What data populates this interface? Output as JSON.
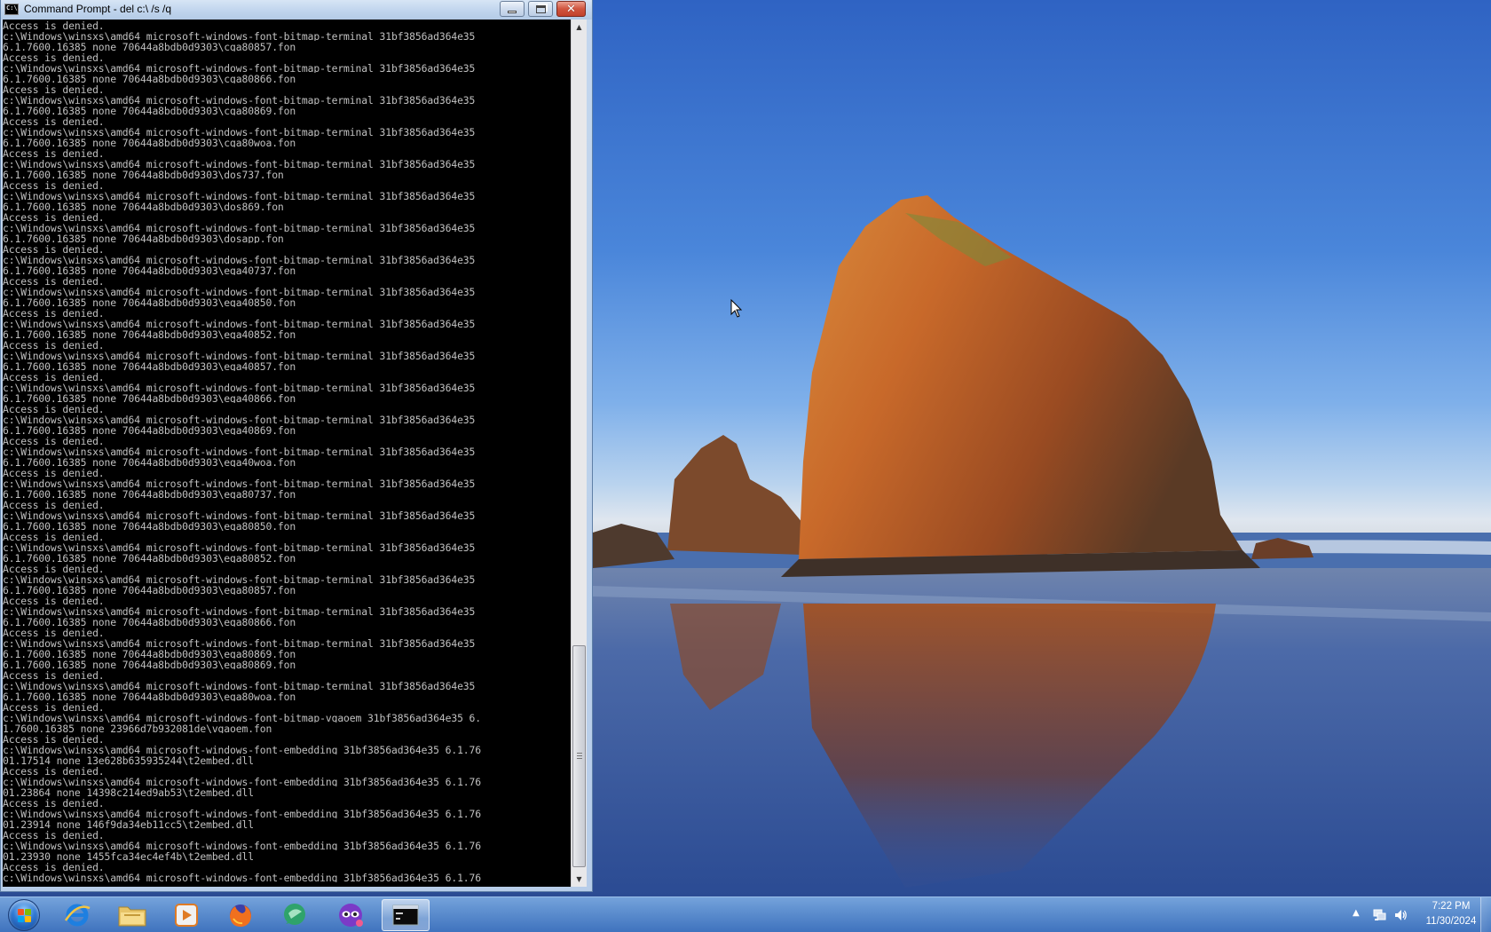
{
  "window": {
    "title": "Command Prompt - del  c:\\ /s /q",
    "app_icon_text": "C:\\.",
    "buttons": {
      "minimize": "minimize",
      "maximize": "restore",
      "close": "✕"
    }
  },
  "console": {
    "text_color": "#c0c0c0",
    "background": "#000000",
    "lines": [
      "Access is denied.",
      "c:\\Windows\\winsxs\\amd64_microsoft-windows-font-bitmap-terminal_31bf3856ad364e35_",
      "6.1.7600.16385_none_70644a8bdb0d9303\\cga80857.fon",
      "Access is denied.",
      "c:\\Windows\\winsxs\\amd64_microsoft-windows-font-bitmap-terminal_31bf3856ad364e35_",
      "6.1.7600.16385_none_70644a8bdb0d9303\\cga80866.fon",
      "Access is denied.",
      "c:\\Windows\\winsxs\\amd64_microsoft-windows-font-bitmap-terminal_31bf3856ad364e35_",
      "6.1.7600.16385_none_70644a8bdb0d9303\\cga80869.fon",
      "Access is denied.",
      "c:\\Windows\\winsxs\\amd64_microsoft-windows-font-bitmap-terminal_31bf3856ad364e35_",
      "6.1.7600.16385_none_70644a8bdb0d9303\\cga80woa.fon",
      "Access is denied.",
      "c:\\Windows\\winsxs\\amd64_microsoft-windows-font-bitmap-terminal_31bf3856ad364e35_",
      "6.1.7600.16385_none_70644a8bdb0d9303\\dos737.fon",
      "Access is denied.",
      "c:\\Windows\\winsxs\\amd64_microsoft-windows-font-bitmap-terminal_31bf3856ad364e35_",
      "6.1.7600.16385_none_70644a8bdb0d9303\\dos869.fon",
      "Access is denied.",
      "c:\\Windows\\winsxs\\amd64_microsoft-windows-font-bitmap-terminal_31bf3856ad364e35_",
      "6.1.7600.16385_none_70644a8bdb0d9303\\dosapp.fon",
      "Access is denied.",
      "c:\\Windows\\winsxs\\amd64_microsoft-windows-font-bitmap-terminal_31bf3856ad364e35_",
      "6.1.7600.16385_none_70644a8bdb0d9303\\ega40737.fon",
      "Access is denied.",
      "c:\\Windows\\winsxs\\amd64_microsoft-windows-font-bitmap-terminal_31bf3856ad364e35_",
      "6.1.7600.16385_none_70644a8bdb0d9303\\ega40850.fon",
      "Access is denied.",
      "c:\\Windows\\winsxs\\amd64_microsoft-windows-font-bitmap-terminal_31bf3856ad364e35_",
      "6.1.7600.16385_none_70644a8bdb0d9303\\ega40852.fon",
      "Access is denied.",
      "c:\\Windows\\winsxs\\amd64_microsoft-windows-font-bitmap-terminal_31bf3856ad364e35_",
      "6.1.7600.16385_none_70644a8bdb0d9303\\ega40857.fon",
      "Access is denied.",
      "c:\\Windows\\winsxs\\amd64_microsoft-windows-font-bitmap-terminal_31bf3856ad364e35_",
      "6.1.7600.16385_none_70644a8bdb0d9303\\ega40866.fon",
      "Access is denied.",
      "c:\\Windows\\winsxs\\amd64_microsoft-windows-font-bitmap-terminal_31bf3856ad364e35_",
      "6.1.7600.16385_none_70644a8bdb0d9303\\ega40869.fon",
      "Access is denied.",
      "c:\\Windows\\winsxs\\amd64_microsoft-windows-font-bitmap-terminal_31bf3856ad364e35_",
      "6.1.7600.16385_none_70644a8bdb0d9303\\ega40woa.fon",
      "Access is denied.",
      "c:\\Windows\\winsxs\\amd64_microsoft-windows-font-bitmap-terminal_31bf3856ad364e35_",
      "6.1.7600.16385_none_70644a8bdb0d9303\\ega80737.fon",
      "Access is denied.",
      "c:\\Windows\\winsxs\\amd64_microsoft-windows-font-bitmap-terminal_31bf3856ad364e35_",
      "6.1.7600.16385_none_70644a8bdb0d9303\\ega80850.fon",
      "Access is denied.",
      "c:\\Windows\\winsxs\\amd64_microsoft-windows-font-bitmap-terminal_31bf3856ad364e35_",
      "6.1.7600.16385_none_70644a8bdb0d9303\\ega80852.fon",
      "Access is denied.",
      "c:\\Windows\\winsxs\\amd64_microsoft-windows-font-bitmap-terminal_31bf3856ad364e35_",
      "6.1.7600.16385_none_70644a8bdb0d9303\\ega80857.fon",
      "Access is denied.",
      "c:\\Windows\\winsxs\\amd64_microsoft-windows-font-bitmap-terminal_31bf3856ad364e35_",
      "6.1.7600.16385_none_70644a8bdb0d9303\\ega80866.fon",
      "Access is denied.",
      "c:\\Windows\\winsxs\\amd64_microsoft-windows-font-bitmap-terminal_31bf3856ad364e35_",
      "6.1.7600.16385_none_70644a8bdb0d9303\\ega80869.fon",
      "6.1.7600.16385_none_70644a8bdb0d9303\\ega80869.fon",
      "Access is denied.",
      "c:\\Windows\\winsxs\\amd64_microsoft-windows-font-bitmap-terminal_31bf3856ad364e35_",
      "6.1.7600.16385_none_70644a8bdb0d9303\\ega80woa.fon",
      "Access is denied.",
      "c:\\Windows\\winsxs\\amd64_microsoft-windows-font-bitmap-vgaoem_31bf3856ad364e35_6.",
      "1.7600.16385_none_23966d7b932081de\\vgaoem.fon",
      "Access is denied.",
      "c:\\Windows\\winsxs\\amd64_microsoft-windows-font-embedding_31bf3856ad364e35_6.1.76",
      "01.17514_none_13e628b635935244\\t2embed.dll",
      "Access is denied.",
      "c:\\Windows\\winsxs\\amd64_microsoft-windows-font-embedding_31bf3856ad364e35_6.1.76",
      "01.23864_none_14398c214ed9ab53\\t2embed.dll",
      "Access is denied.",
      "c:\\Windows\\winsxs\\amd64_microsoft-windows-font-embedding_31bf3856ad364e35_6.1.76",
      "01.23914_none_146f9da34eb11cc5\\t2embed.dll",
      "Access is denied.",
      "c:\\Windows\\winsxs\\amd64_microsoft-windows-font-embedding_31bf3856ad364e35_6.1.76",
      "01.23930_none_1455fca34ec4ef4b\\t2embed.dll",
      "Access is denied.",
      "c:\\Windows\\winsxs\\amd64_microsoft-windows-font-embedding_31bf3856ad364e35_6.1.76"
    ]
  },
  "taskbar": {
    "items": [
      {
        "id": "start",
        "icon": "windows-start-orb-icon"
      },
      {
        "id": "ie",
        "icon": "internet-explorer-icon"
      },
      {
        "id": "explorer",
        "icon": "folder-icon"
      },
      {
        "id": "media",
        "icon": "media-player-icon"
      },
      {
        "id": "firefox",
        "icon": "firefox-icon"
      },
      {
        "id": "greenshot",
        "icon": "green-chat-icon"
      },
      {
        "id": "app6",
        "icon": "purple-mask-icon"
      },
      {
        "id": "cmd",
        "icon": "command-prompt-icon",
        "active": true
      }
    ],
    "tray": {
      "clock_time": "7:22 PM",
      "clock_date": "11/30/2024"
    }
  },
  "colors": {
    "taskbar": "#4f82c6",
    "sky_top": "#2f63c3",
    "rock": "#b8561e",
    "close_button": "#c1412b"
  }
}
